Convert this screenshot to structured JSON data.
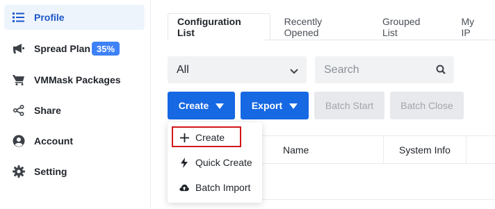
{
  "sidebar": {
    "items": [
      {
        "label": "Profile",
        "icon": "list-icon",
        "active": true
      },
      {
        "label": "Spread Plan",
        "icon": "megaphone-icon",
        "badge": "35%"
      },
      {
        "label": "VMMask Packages",
        "icon": "cart-icon"
      },
      {
        "label": "Share",
        "icon": "share-icon"
      },
      {
        "label": "Account",
        "icon": "user-icon"
      },
      {
        "label": "Setting",
        "icon": "gear-icon"
      }
    ]
  },
  "tabs": [
    {
      "label": "Configuration List",
      "active": true
    },
    {
      "label": "Recently Opened"
    },
    {
      "label": "Grouped List"
    },
    {
      "label": "My IP"
    }
  ],
  "filter": {
    "select_value": "All",
    "search_placeholder": "Search"
  },
  "toolbar": {
    "create_label": "Create",
    "export_label": "Export",
    "batch_start_label": "Batch Start",
    "batch_close_label": "Batch Close"
  },
  "table": {
    "columns": [
      "Name",
      "System Info"
    ]
  },
  "dropdown": {
    "items": [
      {
        "label": "Create",
        "icon": "plus-icon",
        "highlighted": true
      },
      {
        "label": "Quick Create",
        "icon": "lightning-icon"
      },
      {
        "label": "Batch Import",
        "icon": "cloud-upload-icon"
      }
    ]
  },
  "colors": {
    "primary": "#1668e3",
    "active_text": "#1a56c8",
    "badge": "#3e82f7",
    "highlight": "#d3161a"
  }
}
